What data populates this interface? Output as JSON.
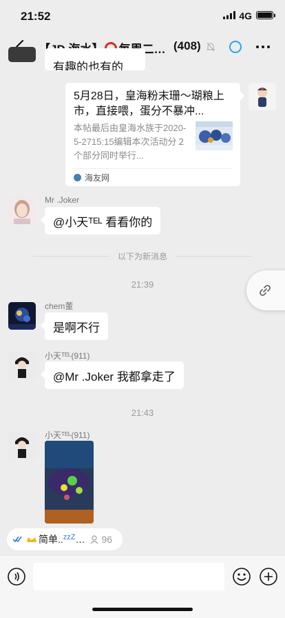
{
  "status_bar": {
    "time": "21:52",
    "network": "4G"
  },
  "nav": {
    "title_prefix": "【JD 海水】",
    "title_suffix": "每周二…",
    "member_count": "(408)"
  },
  "messages": {
    "partial_top_text": "有趣的也有的",
    "card": {
      "title": "5月28日，皇海粉末珊～瑚粮上市，直接喂，蛋分不暴冲...",
      "description": "本帖最后由皇海水族于2020-5-2715:15编辑本次活动分２个部分同时举行...",
      "source": "海友网"
    },
    "joker_name": "Mr .Joker",
    "joker_text": "@小天ᵀᴱᴸ 看看你的",
    "new_divider": "以下为新消息",
    "time1": "21:39",
    "chem_name": "chem董",
    "chem_text": "是啊不行",
    "xiaotian_name": "小天ᵀᴱᴸ(911)",
    "xiaotian_text": "@Mr .Joker 我都拿走了",
    "time2": "21:43",
    "xiaotian_name2": "小天ᵀᴱᴸ(911)"
  },
  "group_chip": {
    "label": "简单..",
    "zz": "zzZ",
    "ellipsis": "…",
    "count": "96"
  },
  "colors": {
    "background": "#ededed",
    "accent_ring": "#e0281c",
    "link_blue": "#2aa3e8"
  }
}
